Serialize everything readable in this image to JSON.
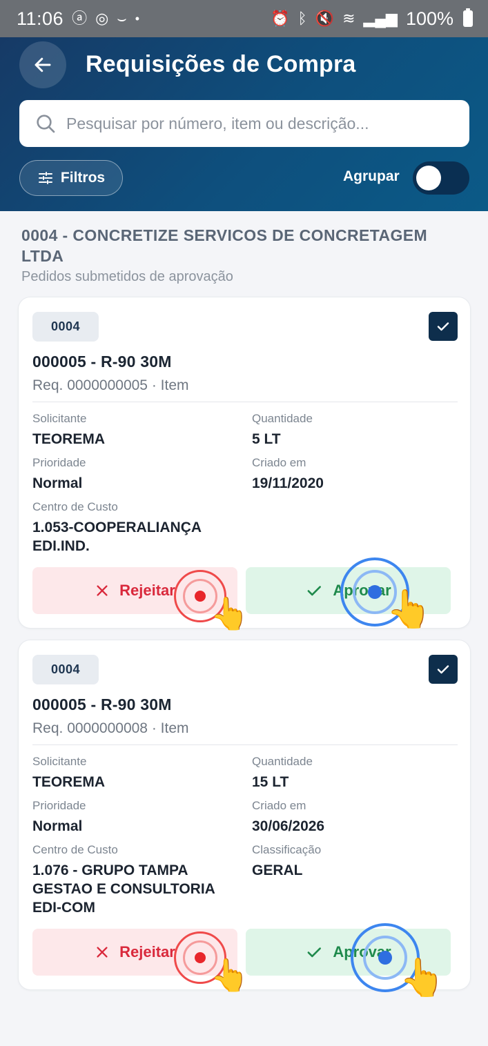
{
  "status_bar": {
    "time": "11:06",
    "battery": "100%",
    "icons": [
      "threads-icon",
      "instagram-icon",
      "amazon-icon",
      "alarm-icon",
      "bluetooth-icon",
      "mute-icon",
      "wifi-icon",
      "volte-icon",
      "signal-icon",
      "battery-icon"
    ]
  },
  "header": {
    "title": "Requisições de Compra",
    "search_placeholder": "Pesquisar por número, item ou descrição...",
    "filters_label": "Filtros",
    "group_label": "Agrupar",
    "group_toggle_on": false
  },
  "group": {
    "title": "0004 - CONCRETIZE SERVICOS DE CONCRETAGEM LTDA",
    "subtitle": "Pedidos submetidos de aprovação"
  },
  "cards": [
    {
      "badge": "0004",
      "checked": true,
      "title": "000005 - R-90 30M",
      "subtitle": "Req. 0000000005 · Item",
      "requester_label": "Solicitante",
      "requester": "TEOREMA",
      "quantity_label": "Quantidade",
      "quantity": "5 LT",
      "priority_label": "Prioridade",
      "priority": "Normal",
      "created_label": "Criado em",
      "created": "19/11/2020",
      "cost_center_label": "Centro de Custo",
      "cost_center": "1.053-COOPERALIANÇA EDI.IND.",
      "reject_label": "Rejeitar",
      "approve_label": "Aprovar"
    },
    {
      "badge": "0004",
      "checked": true,
      "title": "000005 - R-90 30M",
      "subtitle": "Req. 0000000008 · Item",
      "requester_label": "Solicitante",
      "requester": "TEOREMA",
      "quantity_label": "Quantidade",
      "quantity": "15 LT",
      "priority_label": "Prioridade",
      "priority": "Normal",
      "created_label": "Criado em",
      "created": "30/06/2026",
      "cost_center_label": "Centro de Custo",
      "cost_center": "1.076 - GRUPO TAMPA GESTAO E CONSULTORIA EDI-COM",
      "classification_label": "Classificação",
      "classification": "GERAL",
      "reject_label": "Rejeitar",
      "approve_label": "Aprovar"
    }
  ],
  "colors": {
    "header_start": "#163a66",
    "header_end": "#0b5a87",
    "reject_text": "#d9293c",
    "reject_bg": "#fde8ea",
    "approve_text": "#1f8a4c",
    "approve_bg": "#dff5e8",
    "checkbox": "#0e2e4c"
  }
}
